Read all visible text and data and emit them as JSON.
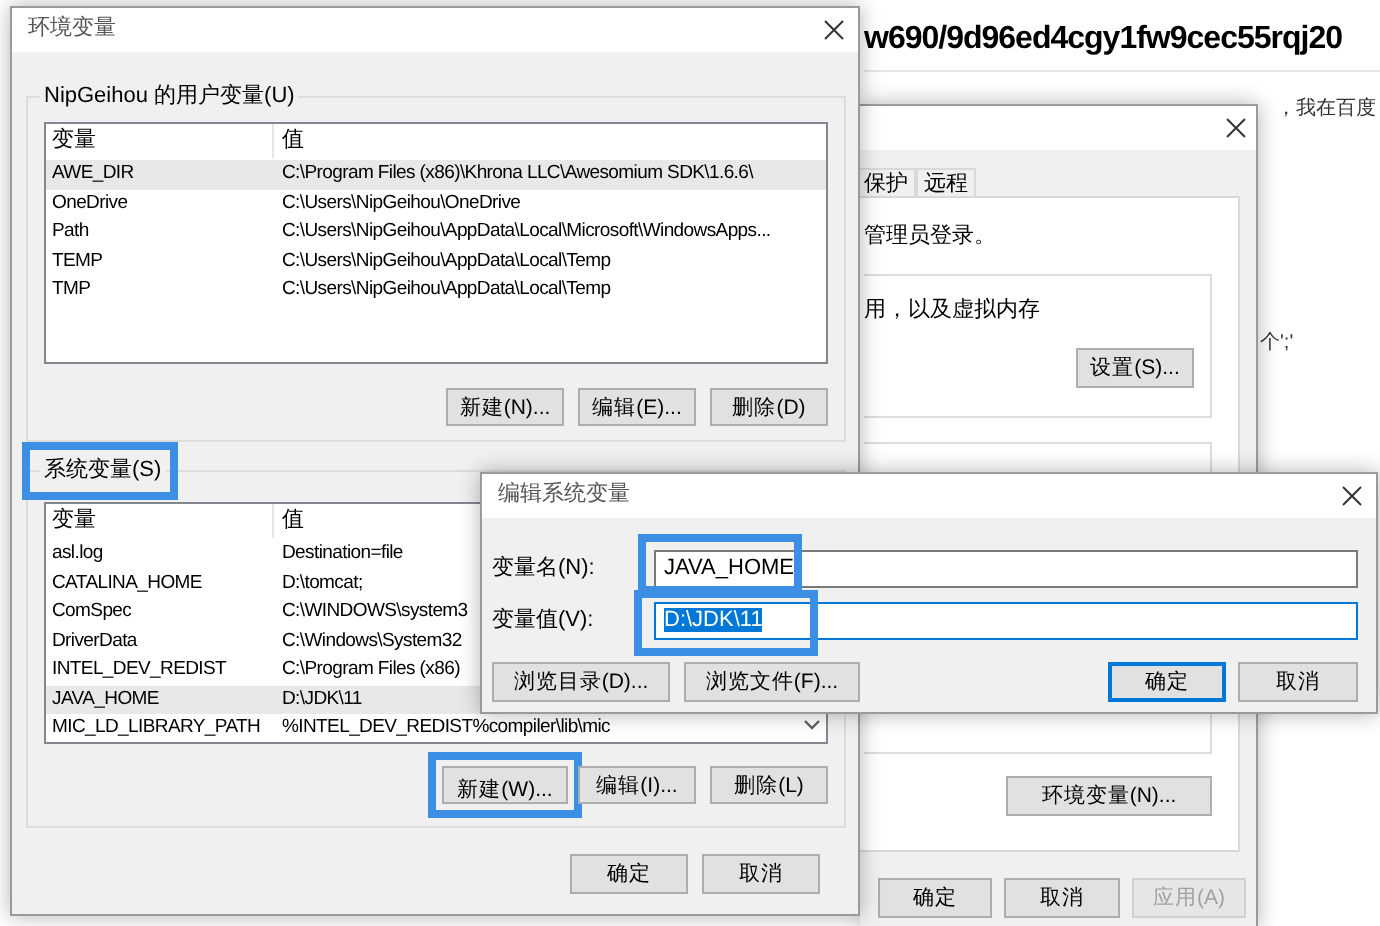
{
  "background_page": {
    "heading": "w690/9d96ed4cgy1fw9cec55rqj20",
    "texts": [
      "，我在百度",
      "个';'"
    ]
  },
  "system_properties": {
    "tabs": [
      {
        "label": "保护",
        "selected": false
      },
      {
        "label": "远程",
        "selected": false
      }
    ],
    "text": "管理员登录。",
    "group_text": "用，以及虚拟内存",
    "settings_button": "设置(S)...",
    "env_button": "环境变量(N)...",
    "buttons": [
      {
        "label": "确定",
        "disabled": false
      },
      {
        "label": "取消",
        "disabled": false
      },
      {
        "label": "应用(A)",
        "disabled": true
      }
    ]
  },
  "env_dialog": {
    "title": "环境变量",
    "groups": [
      {
        "label": "NipGeihou 的用户变量(U)",
        "highlighted": false,
        "columns": [
          "变量",
          "值"
        ],
        "scrollbar": false,
        "rows": [
          {
            "name": "AWE_DIR",
            "value": "C:\\Program Files (x86)\\Khrona LLC\\Awesomium SDK\\1.6.6\\",
            "selected": true
          },
          {
            "name": "OneDrive",
            "value": "C:\\Users\\NipGeihou\\OneDrive",
            "selected": false
          },
          {
            "name": "Path",
            "value": "C:\\Users\\NipGeihou\\AppData\\Local\\Microsoft\\WindowsApps...",
            "selected": false
          },
          {
            "name": "TEMP",
            "value": "C:\\Users\\NipGeihou\\AppData\\Local\\Temp",
            "selected": false
          },
          {
            "name": "TMP",
            "value": "C:\\Users\\NipGeihou\\AppData\\Local\\Temp",
            "selected": false
          }
        ],
        "buttons": [
          {
            "label": "新建(N)...",
            "highlighted": false
          },
          {
            "label": "编辑(E)...",
            "highlighted": false
          },
          {
            "label": "删除(D)",
            "highlighted": false
          }
        ]
      },
      {
        "label": "系统变量(S)",
        "highlighted": true,
        "columns": [
          "变量",
          "值"
        ],
        "scrollbar": true,
        "rows": [
          {
            "name": "asl.log",
            "value": "Destination=file",
            "selected": false
          },
          {
            "name": "CATALINA_HOME",
            "value": "D:\\tomcat;",
            "selected": false
          },
          {
            "name": "ComSpec",
            "value": "C:\\WINDOWS\\system3",
            "selected": false
          },
          {
            "name": "DriverData",
            "value": "C:\\Windows\\System32",
            "selected": false
          },
          {
            "name": "INTEL_DEV_REDIST",
            "value": "C:\\Program Files (x86)",
            "selected": false
          },
          {
            "name": "JAVA_HOME",
            "value": "D:\\JDK\\11",
            "selected": true
          },
          {
            "name": "MIC_LD_LIBRARY_PATH",
            "value": "%INTEL_DEV_REDIST%compiler\\lib\\mic",
            "selected": false
          }
        ],
        "buttons": [
          {
            "label": "新建(W)...",
            "highlighted": true
          },
          {
            "label": "编辑(I)...",
            "highlighted": false
          },
          {
            "label": "删除(L)",
            "highlighted": false
          }
        ]
      }
    ],
    "buttons": [
      {
        "label": "确定"
      },
      {
        "label": "取消"
      }
    ]
  },
  "edit_dialog": {
    "title": "编辑系统变量",
    "fields": [
      {
        "label": "变量名(N):",
        "value": "JAVA_HOME",
        "focused": false,
        "text_selected": false,
        "highlighted": true
      },
      {
        "label": "变量值(V):",
        "value": "D:\\JDK\\11",
        "focused": true,
        "text_selected": true,
        "highlighted": true
      }
    ],
    "buttons": [
      {
        "label": "浏览目录(D)...",
        "default": false
      },
      {
        "label": "浏览文件(F)...",
        "default": false
      },
      {
        "label": "确定",
        "default": true
      },
      {
        "label": "取消",
        "default": false
      }
    ]
  }
}
